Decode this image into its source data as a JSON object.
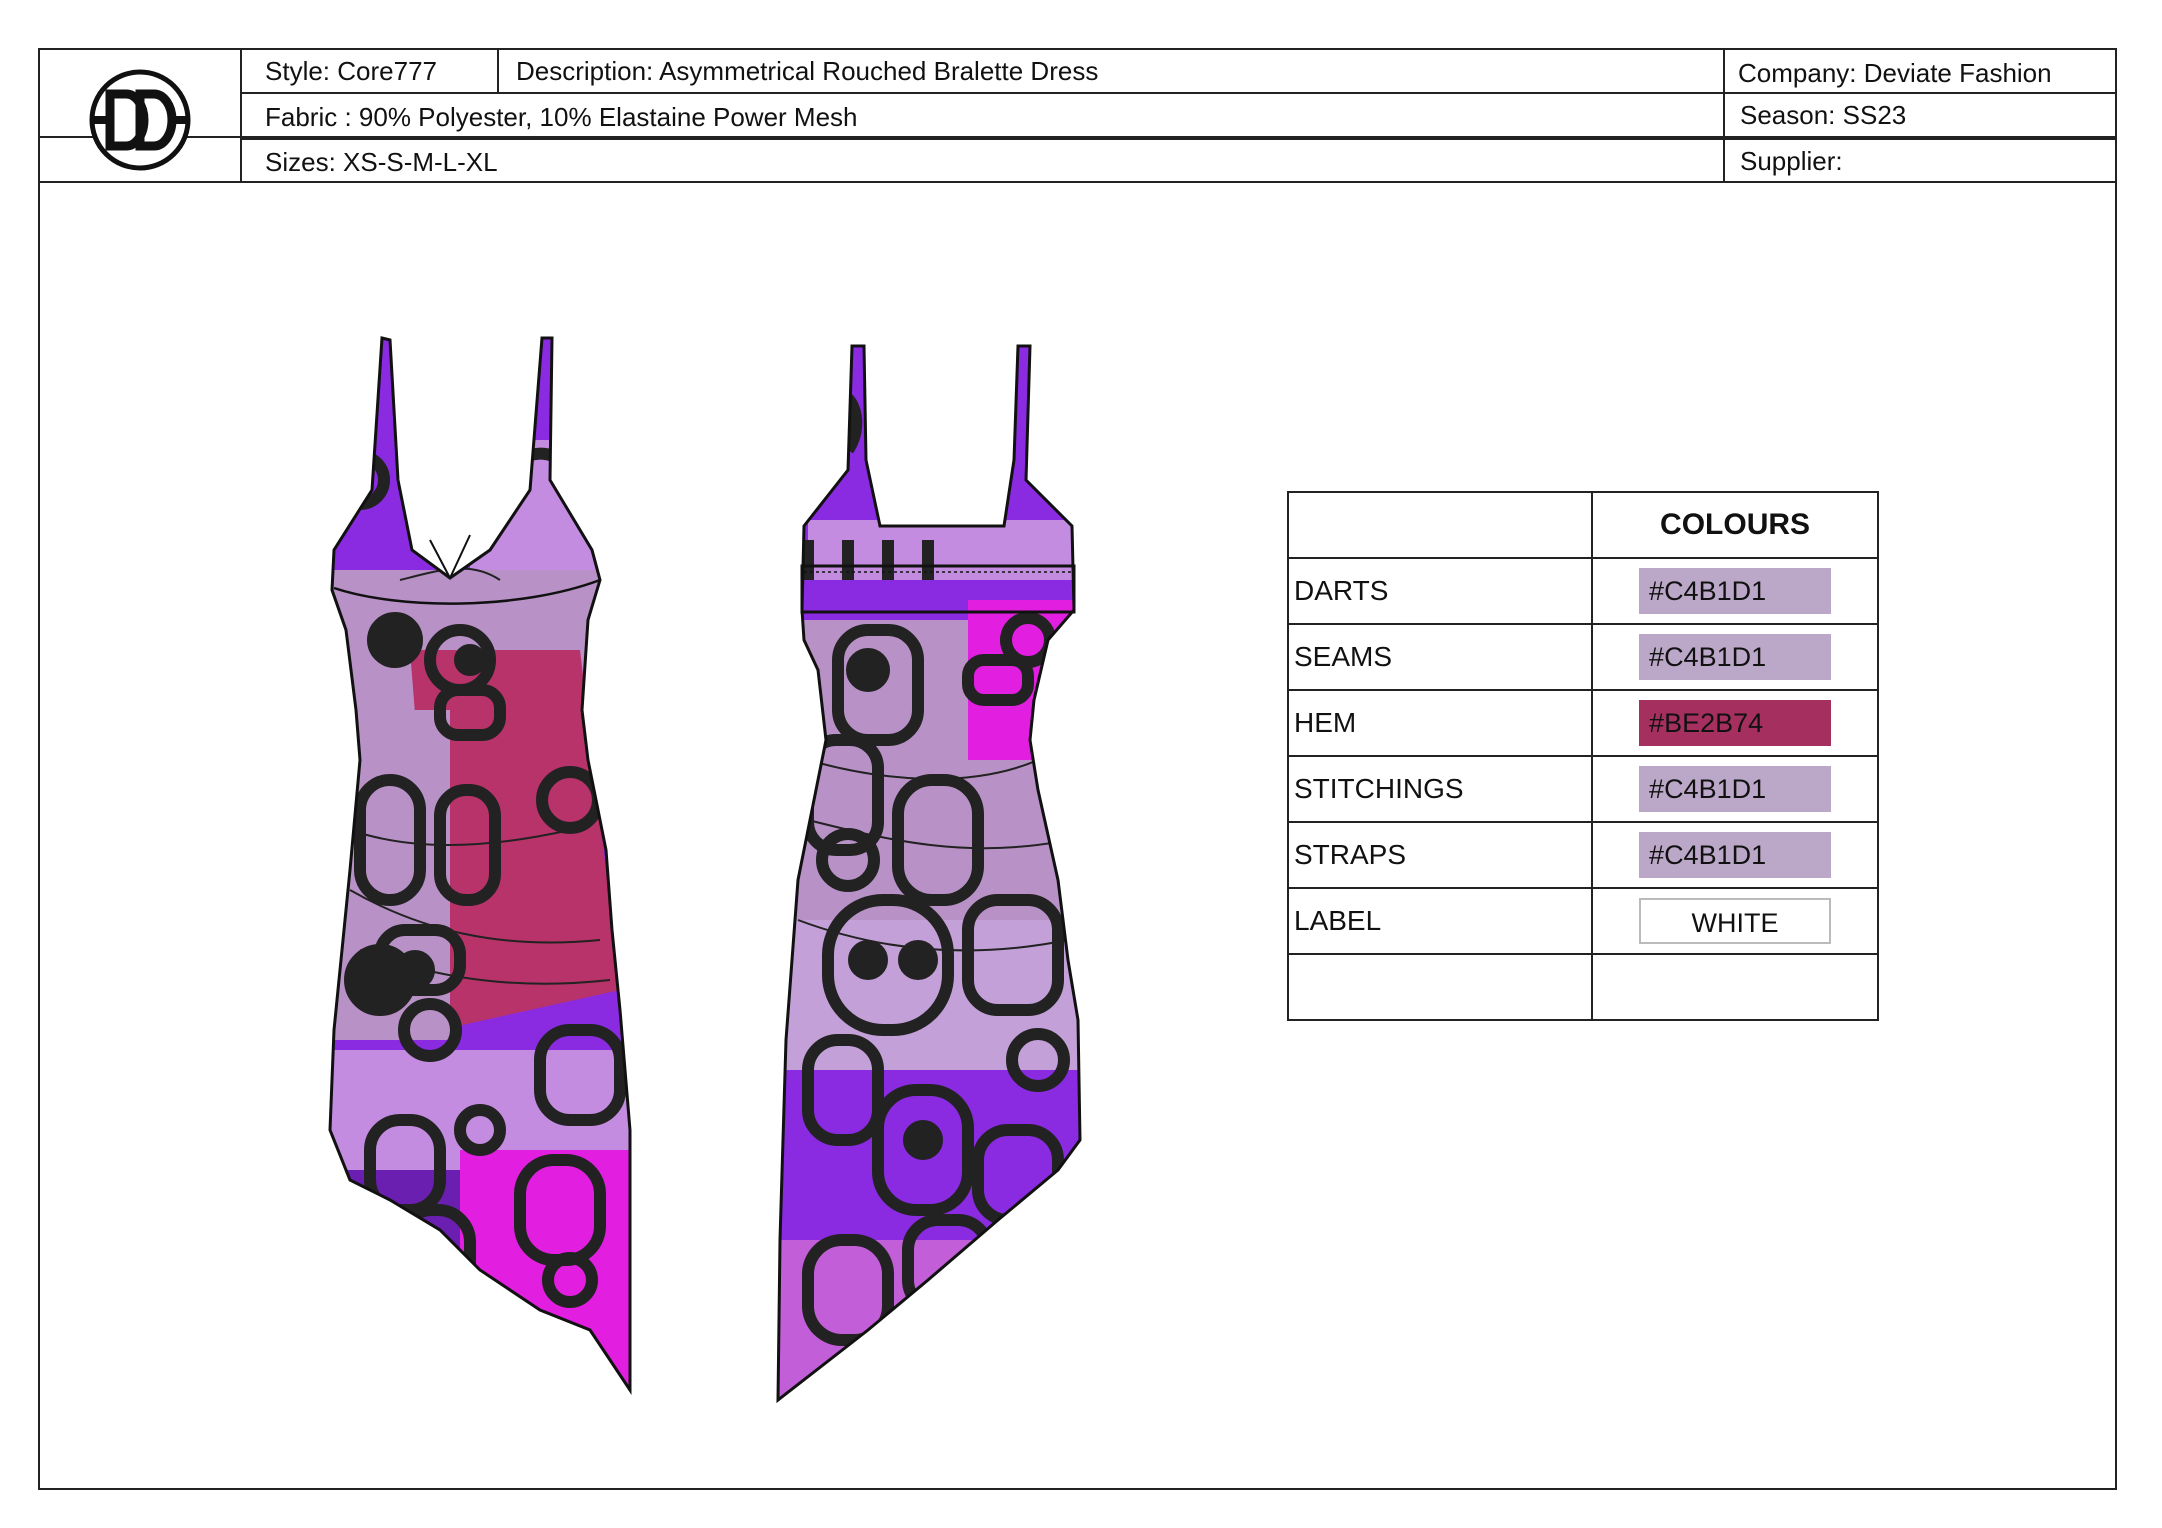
{
  "header": {
    "style": "Style: Core777",
    "description": "Description: Asymmetrical Rouched Bralette Dress",
    "company": "Company: Deviate Fashion",
    "fabric": "Fabric : 90% Polyester, 10% Elastaine Power Mesh",
    "season": "Season: SS23",
    "sizes": "Sizes: XS-S-M-L-XL",
    "supplier": "Supplier:"
  },
  "logo": {
    "text": "DD",
    "icon": "brand-logo"
  },
  "colours_table": {
    "heading": "COLOURS",
    "rows": [
      {
        "label": "DARTS",
        "value": "#C4B1D1",
        "color": "#BBA8C8"
      },
      {
        "label": "SEAMS",
        "value": "#C4B1D1",
        "color": "#BBA8C8"
      },
      {
        "label": "HEM",
        "value": "#BE2B74",
        "color": "#A5305F"
      },
      {
        "label": "STITCHINGS",
        "value": "#C4B1D1",
        "color": "#BBA8C8"
      },
      {
        "label": "STRAPS",
        "value": "#C4B1D1",
        "color": "#BBA8C8"
      },
      {
        "label": "LABEL",
        "value": "WHITE",
        "color": "#FFFFFF"
      },
      {
        "label": "",
        "value": "",
        "color": ""
      }
    ]
  },
  "sketches": {
    "front": "dress-front-sketch",
    "back": "dress-back-sketch"
  },
  "print_colors": [
    "#8A2BE2",
    "#C38CE0",
    "#E21FE0",
    "#B8336A",
    "#6A1FB0",
    "#222222"
  ]
}
